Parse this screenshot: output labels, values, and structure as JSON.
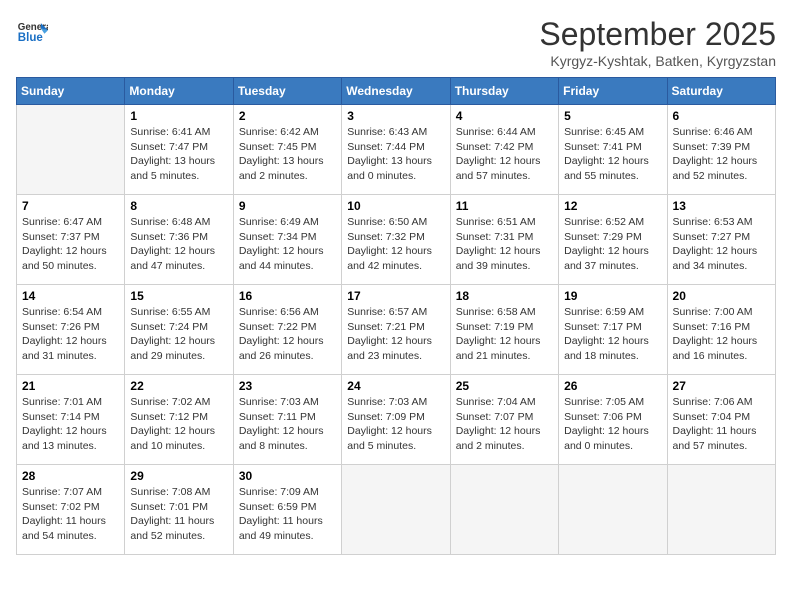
{
  "header": {
    "logo_line1": "General",
    "logo_line2": "Blue",
    "month_title": "September 2025",
    "location": "Kyrgyz-Kyshtak, Batken, Kyrgyzstan"
  },
  "days_of_week": [
    "Sunday",
    "Monday",
    "Tuesday",
    "Wednesday",
    "Thursday",
    "Friday",
    "Saturday"
  ],
  "weeks": [
    [
      {
        "day": "",
        "info": ""
      },
      {
        "day": "1",
        "info": "Sunrise: 6:41 AM\nSunset: 7:47 PM\nDaylight: 13 hours\nand 5 minutes."
      },
      {
        "day": "2",
        "info": "Sunrise: 6:42 AM\nSunset: 7:45 PM\nDaylight: 13 hours\nand 2 minutes."
      },
      {
        "day": "3",
        "info": "Sunrise: 6:43 AM\nSunset: 7:44 PM\nDaylight: 13 hours\nand 0 minutes."
      },
      {
        "day": "4",
        "info": "Sunrise: 6:44 AM\nSunset: 7:42 PM\nDaylight: 12 hours\nand 57 minutes."
      },
      {
        "day": "5",
        "info": "Sunrise: 6:45 AM\nSunset: 7:41 PM\nDaylight: 12 hours\nand 55 minutes."
      },
      {
        "day": "6",
        "info": "Sunrise: 6:46 AM\nSunset: 7:39 PM\nDaylight: 12 hours\nand 52 minutes."
      }
    ],
    [
      {
        "day": "7",
        "info": "Sunrise: 6:47 AM\nSunset: 7:37 PM\nDaylight: 12 hours\nand 50 minutes."
      },
      {
        "day": "8",
        "info": "Sunrise: 6:48 AM\nSunset: 7:36 PM\nDaylight: 12 hours\nand 47 minutes."
      },
      {
        "day": "9",
        "info": "Sunrise: 6:49 AM\nSunset: 7:34 PM\nDaylight: 12 hours\nand 44 minutes."
      },
      {
        "day": "10",
        "info": "Sunrise: 6:50 AM\nSunset: 7:32 PM\nDaylight: 12 hours\nand 42 minutes."
      },
      {
        "day": "11",
        "info": "Sunrise: 6:51 AM\nSunset: 7:31 PM\nDaylight: 12 hours\nand 39 minutes."
      },
      {
        "day": "12",
        "info": "Sunrise: 6:52 AM\nSunset: 7:29 PM\nDaylight: 12 hours\nand 37 minutes."
      },
      {
        "day": "13",
        "info": "Sunrise: 6:53 AM\nSunset: 7:27 PM\nDaylight: 12 hours\nand 34 minutes."
      }
    ],
    [
      {
        "day": "14",
        "info": "Sunrise: 6:54 AM\nSunset: 7:26 PM\nDaylight: 12 hours\nand 31 minutes."
      },
      {
        "day": "15",
        "info": "Sunrise: 6:55 AM\nSunset: 7:24 PM\nDaylight: 12 hours\nand 29 minutes."
      },
      {
        "day": "16",
        "info": "Sunrise: 6:56 AM\nSunset: 7:22 PM\nDaylight: 12 hours\nand 26 minutes."
      },
      {
        "day": "17",
        "info": "Sunrise: 6:57 AM\nSunset: 7:21 PM\nDaylight: 12 hours\nand 23 minutes."
      },
      {
        "day": "18",
        "info": "Sunrise: 6:58 AM\nSunset: 7:19 PM\nDaylight: 12 hours\nand 21 minutes."
      },
      {
        "day": "19",
        "info": "Sunrise: 6:59 AM\nSunset: 7:17 PM\nDaylight: 12 hours\nand 18 minutes."
      },
      {
        "day": "20",
        "info": "Sunrise: 7:00 AM\nSunset: 7:16 PM\nDaylight: 12 hours\nand 16 minutes."
      }
    ],
    [
      {
        "day": "21",
        "info": "Sunrise: 7:01 AM\nSunset: 7:14 PM\nDaylight: 12 hours\nand 13 minutes."
      },
      {
        "day": "22",
        "info": "Sunrise: 7:02 AM\nSunset: 7:12 PM\nDaylight: 12 hours\nand 10 minutes."
      },
      {
        "day": "23",
        "info": "Sunrise: 7:03 AM\nSunset: 7:11 PM\nDaylight: 12 hours\nand 8 minutes."
      },
      {
        "day": "24",
        "info": "Sunrise: 7:03 AM\nSunset: 7:09 PM\nDaylight: 12 hours\nand 5 minutes."
      },
      {
        "day": "25",
        "info": "Sunrise: 7:04 AM\nSunset: 7:07 PM\nDaylight: 12 hours\nand 2 minutes."
      },
      {
        "day": "26",
        "info": "Sunrise: 7:05 AM\nSunset: 7:06 PM\nDaylight: 12 hours\nand 0 minutes."
      },
      {
        "day": "27",
        "info": "Sunrise: 7:06 AM\nSunset: 7:04 PM\nDaylight: 11 hours\nand 57 minutes."
      }
    ],
    [
      {
        "day": "28",
        "info": "Sunrise: 7:07 AM\nSunset: 7:02 PM\nDaylight: 11 hours\nand 54 minutes."
      },
      {
        "day": "29",
        "info": "Sunrise: 7:08 AM\nSunset: 7:01 PM\nDaylight: 11 hours\nand 52 minutes."
      },
      {
        "day": "30",
        "info": "Sunrise: 7:09 AM\nSunset: 6:59 PM\nDaylight: 11 hours\nand 49 minutes."
      },
      {
        "day": "",
        "info": ""
      },
      {
        "day": "",
        "info": ""
      },
      {
        "day": "",
        "info": ""
      },
      {
        "day": "",
        "info": ""
      }
    ]
  ]
}
